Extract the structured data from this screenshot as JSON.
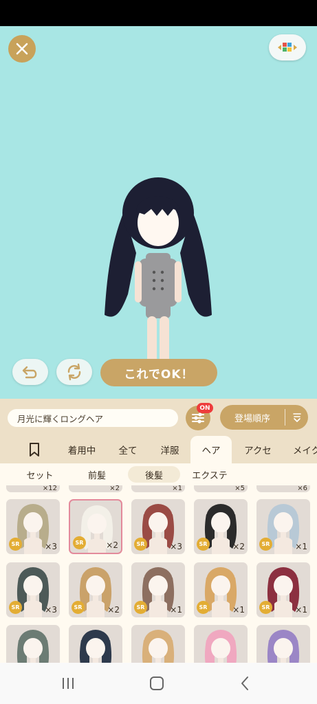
{
  "header": {
    "close_icon": "close-icon",
    "menu_icon": "colorful-blocks-icon"
  },
  "controls": {
    "undo_icon": "undo-arrow-icon",
    "reset_icon": "rotate-icon",
    "ok_label": "これでOK！"
  },
  "itembar": {
    "item_name": "月光に輝くロングヘア",
    "filter_icon": "sliders-icon",
    "filter_badge": "ON",
    "sort_label": "登場順序",
    "sort_icon": "sort-down-icon"
  },
  "tabs": {
    "bookmark_icon": "bookmark-icon",
    "items": [
      {
        "label": "着用中"
      },
      {
        "label": "全て"
      },
      {
        "label": "洋服"
      },
      {
        "label": "ヘア"
      },
      {
        "label": "アクセ"
      },
      {
        "label": "メイク"
      }
    ],
    "active": "ヘア"
  },
  "subtabs": {
    "items": [
      {
        "label": "セット"
      },
      {
        "label": "前髪"
      },
      {
        "label": "後髪"
      },
      {
        "label": "エクステ"
      }
    ],
    "active": "後髪"
  },
  "grid": {
    "partial_top_counts": [
      "×12",
      "×2",
      "×1",
      "×5",
      "×6"
    ],
    "rows": [
      [
        {
          "rarity": "SR",
          "count": "×3",
          "hair": "#b8ad8c"
        },
        {
          "rarity": "SR",
          "count": "×2",
          "hair": "#f3f0e8",
          "selected": true
        },
        {
          "rarity": "SR",
          "count": "×3",
          "hair": "#9a4b45"
        },
        {
          "rarity": "SR",
          "count": "×2",
          "hair": "#2b2b2b"
        },
        {
          "rarity": "SR",
          "count": "×1",
          "hair": "#b8c9d6"
        }
      ],
      [
        {
          "rarity": "SR",
          "count": "×3",
          "hair": "#4d5a58"
        },
        {
          "rarity": "SR",
          "count": "×2",
          "hair": "#caa26a"
        },
        {
          "rarity": "SR",
          "count": "×1",
          "hair": "#8d6f60"
        },
        {
          "rarity": "SR",
          "count": "×1",
          "hair": "#d9a866"
        },
        {
          "rarity": "SR",
          "count": "×1",
          "hair": "#8c3040"
        }
      ],
      [
        {
          "hair": "#6c7c74"
        },
        {
          "hair": "#2e3a4c"
        },
        {
          "hair": "#d9b07a"
        },
        {
          "hair": "#f0a8c0"
        },
        {
          "hair": "#9b86c6"
        }
      ]
    ]
  },
  "navbar": {
    "recents_icon": "recents-icon",
    "home_icon": "home-icon",
    "back_icon": "back-icon"
  }
}
